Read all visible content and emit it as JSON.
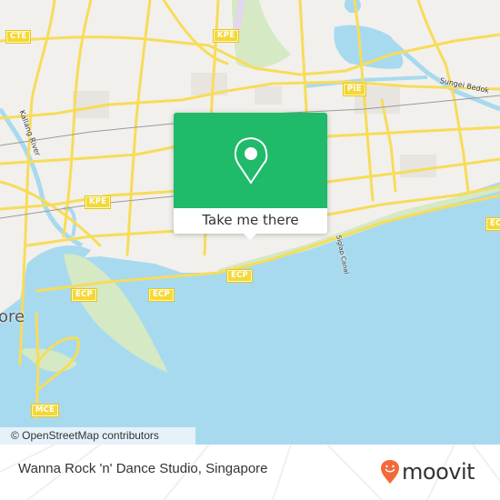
{
  "map": {
    "attribution": "© OpenStreetMap contributors",
    "highway_shields": [
      "CTE",
      "KPE",
      "PIE",
      "KPE",
      "ECP",
      "ECP",
      "ECP",
      "ECP",
      "MCE"
    ],
    "labels": {
      "river_kallang": "Kallang River",
      "river_bedok": "Sungei Bedok",
      "canal": "Siglap Canal",
      "city_fragment": "ore"
    },
    "colors": {
      "water": "#a8daef",
      "land": "#f2f0ec",
      "park": "#d4e9c4",
      "road": "#f7dc5a",
      "shield": "#f4d836"
    }
  },
  "popup": {
    "icon": "map-pin-icon",
    "button_label": "Take me there",
    "color": "#1fba6a"
  },
  "footer": {
    "place_name": "Wanna Rock 'n' Dance Studio, Singapore",
    "brand": "moovit",
    "brand_icon": "moovit-smile-pin-icon",
    "brand_color": "#f26a3a"
  }
}
